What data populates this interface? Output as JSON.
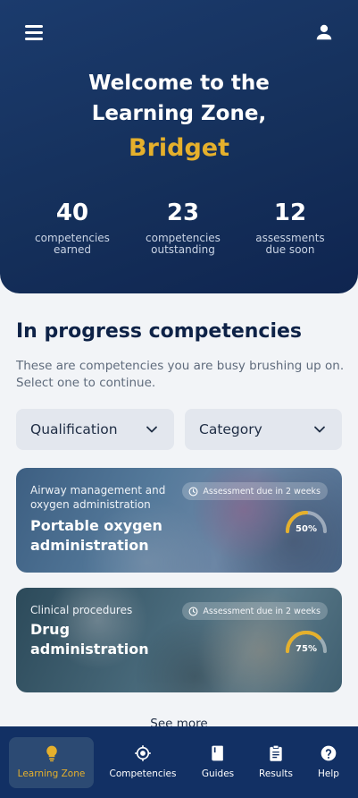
{
  "header": {
    "menu_icon": "hamburger-menu-icon",
    "profile_icon": "user-icon",
    "welcome_line1": "Welcome to the",
    "welcome_line2": "Learning Zone,",
    "user_name": "Bridget"
  },
  "stats": [
    {
      "value": "40",
      "label_line1": "competencies",
      "label_line2": "earned"
    },
    {
      "value": "23",
      "label_line1": "competencies",
      "label_line2": "outstanding"
    },
    {
      "value": "12",
      "label_line1": "assessments",
      "label_line2": "due soon"
    }
  ],
  "section": {
    "title": "In progress competencies",
    "description": "These are competencies you are busy brushing up on. Select one to continue."
  },
  "filters": {
    "qualification": "Qualification",
    "category": "Category"
  },
  "cards": [
    {
      "category": "Airway management and oxygen administration",
      "title_line1": "Portable oxygen",
      "title_line2": "administration",
      "badge": "Assessment due in 2 weeks",
      "progress": 0.5,
      "progress_label": "50%"
    },
    {
      "category": "Clinical procedures",
      "title_line1": "Drug",
      "title_line2": "administration",
      "badge": "Assessment due in 2 weeks",
      "progress": 0.75,
      "progress_label": "75%"
    }
  ],
  "see_more": "See more",
  "nav": [
    {
      "label": "Learning Zone",
      "icon": "lightbulb-icon",
      "active": true
    },
    {
      "label": "Competencies",
      "icon": "target-icon",
      "active": false
    },
    {
      "label": "Guides",
      "icon": "book-icon",
      "active": false
    },
    {
      "label": "Results",
      "icon": "clipboard-icon",
      "active": false
    },
    {
      "label": "Help",
      "icon": "help-circle-icon",
      "active": false
    }
  ],
  "colors": {
    "navy": "#15305b",
    "gold": "#e5b02c",
    "background": "#f2f4f7"
  }
}
